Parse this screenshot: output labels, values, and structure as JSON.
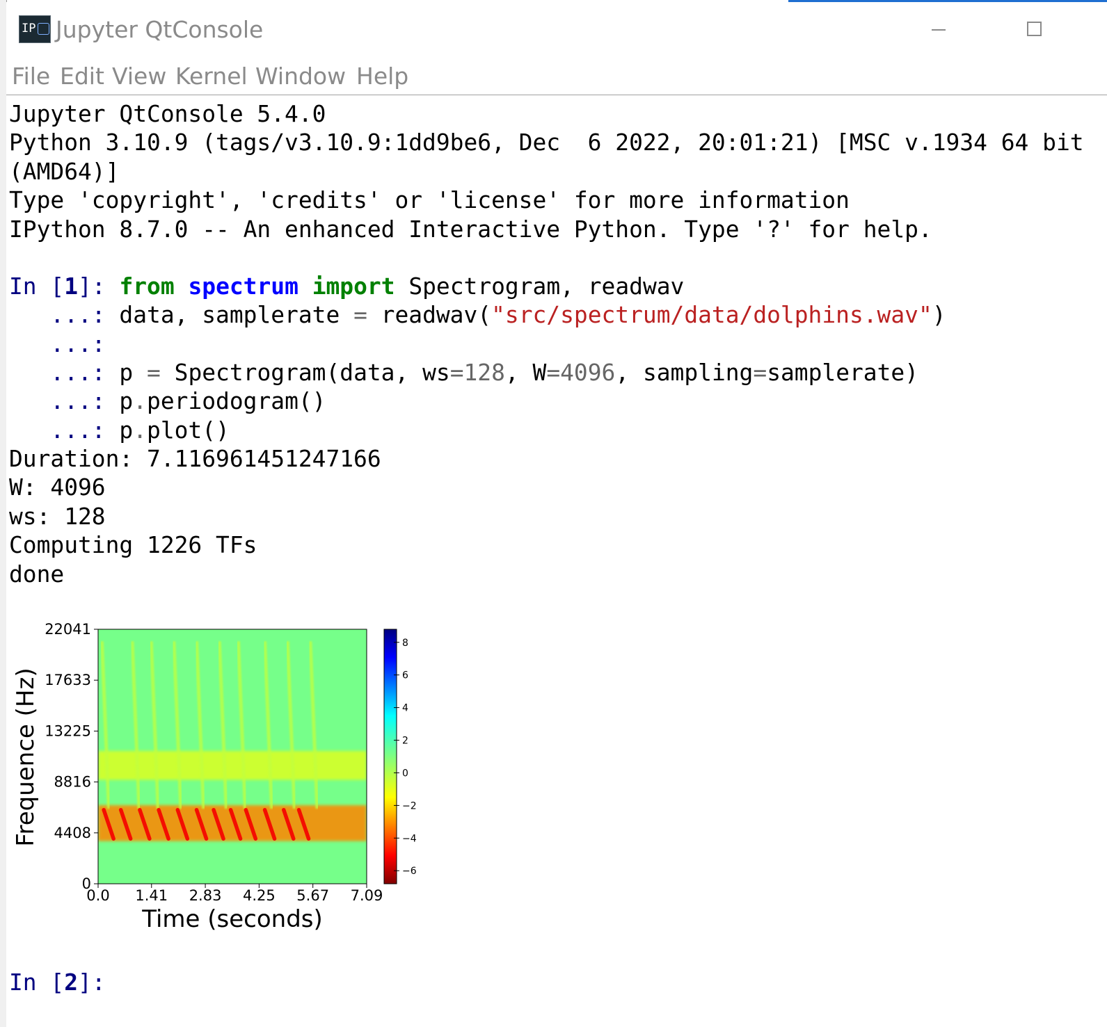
{
  "window": {
    "title": "Jupyter QtConsole",
    "icon": "ipython-app-icon",
    "icon_text": "IP"
  },
  "menu": [
    "File",
    "Edit",
    "View",
    "Kernel",
    "Window",
    "Help"
  ],
  "banner": [
    "Jupyter QtConsole 5.4.0",
    "Python 3.10.9 (tags/v3.10.9:1dd9be6, Dec  6 2022, 20:01:21) [MSC v.1934 64 bit",
    "(AMD64)]",
    "Type 'copyright', 'credits' or 'license' for more information",
    "IPython 8.7.0 -- An enhanced Interactive Python. Type '?' for help."
  ],
  "cell1": {
    "prompt_in": "In [",
    "prompt_num": "1",
    "prompt_close": "]: ",
    "cont_prompt": "   ...: ",
    "line1": {
      "kw_from": "from",
      "module": "spectrum",
      "kw_import": "import",
      "names": " Spectrogram, readwav"
    },
    "line2": {
      "lhs": "data, samplerate ",
      "eq": "=",
      "call": " readwav(",
      "string": "\"src/spectrum/data/dolphins.wav\"",
      "close": ")"
    },
    "line4": {
      "lhs": "p ",
      "eq": "=",
      "call": " Spectrogram(data, ws",
      "eq2": "=",
      "ws": "128",
      "mid": ", W",
      "eq3": "=",
      "W": "4096",
      "mid2": ", sampling",
      "eq4": "=",
      "tail": "samplerate)"
    },
    "line5": {
      "obj": "p",
      "dot": ".",
      "method": "periodogram()"
    },
    "line6": {
      "obj": "p",
      "dot": ".",
      "method": "plot()"
    }
  },
  "output": [
    "Duration: 7.116961451247166",
    "W: 4096",
    "ws: 128",
    "Computing 1226 TFs",
    "done"
  ],
  "cell2": {
    "prompt_in": "In [",
    "prompt_num": "2",
    "prompt_close": "]: "
  },
  "chart_data": {
    "type": "heatmap",
    "xlabel": "Time (seconds)",
    "ylabel": "Frequence (Hz)",
    "xlim": [
      0,
      7.09
    ],
    "ylim": [
      0,
      22041
    ],
    "xticks": [
      0.0,
      1.41,
      2.83,
      4.25,
      5.67,
      7.09
    ],
    "xtick_labels": [
      "0.0",
      "1.41",
      "2.83",
      "4.25",
      "5.67",
      "7.09"
    ],
    "yticks": [
      0,
      4408,
      8816,
      13225,
      17633,
      22041
    ],
    "ytick_labels": [
      "0",
      "4408",
      "8816",
      "13225",
      "17633",
      "22041"
    ],
    "colormap": "jet_r",
    "colorbar": {
      "range": [
        -6.8,
        8.8
      ],
      "ticks": [
        -6,
        -4,
        -2,
        0,
        2,
        4,
        6,
        8
      ],
      "tick_labels": [
        "−6",
        "−4",
        "−2",
        "0",
        "2",
        "4",
        "6",
        "8"
      ]
    },
    "background_value": 1.2,
    "bands": [
      {
        "t": [
          0.0,
          7.09
        ],
        "f_low": 3700,
        "f_high": 6800,
        "value": -3.2
      },
      {
        "t": [
          0.0,
          7.09
        ],
        "f_low": 9000,
        "f_high": 11500,
        "value": -0.8
      }
    ],
    "clicks_time": [
      0.15,
      0.6,
      1.1,
      1.6,
      2.1,
      2.6,
      3.05,
      3.5,
      3.9,
      4.4,
      4.9,
      5.3
    ],
    "clicks_value": -5.2,
    "clicks_f_range": [
      3900,
      6400
    ],
    "upper_clicks_time": [
      0.1,
      0.9,
      1.4,
      2.0,
      2.6,
      3.2,
      3.7,
      4.4,
      5.0,
      5.6
    ],
    "upper_clicks_value": -0.3,
    "upper_clicks_f_range": [
      6500,
      21000
    ]
  },
  "colors": {
    "prompt": "#000080",
    "keyword": "#008000",
    "module": "#0000ff",
    "string": "#ba2121",
    "number": "#666666",
    "accent": "#1f6fd1"
  }
}
